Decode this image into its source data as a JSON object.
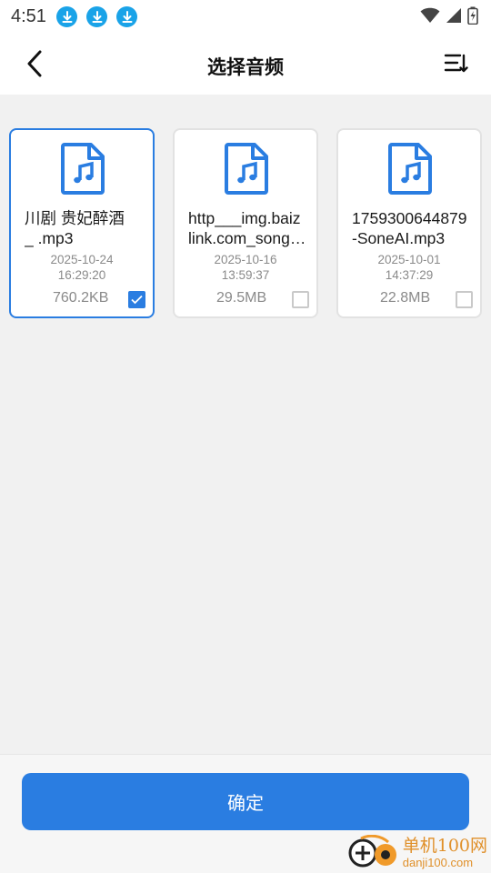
{
  "status_bar": {
    "time": "4:51",
    "notification_icons": [
      "download-icon",
      "download-icon",
      "download-icon"
    ],
    "system_icons": [
      "wifi-icon",
      "signal-icon",
      "battery-charging-icon"
    ]
  },
  "header": {
    "title": "选择音频",
    "back_icon": "chevron-left-icon",
    "sort_icon": "sort-icon"
  },
  "files": [
    {
      "name_line1": "川剧 贵妃醉酒",
      "name_line2": "_ .mp3",
      "date": "2025-10-24",
      "time": "16:29:20",
      "size": "760.2KB",
      "selected": true
    },
    {
      "name_line1": "http___img.baiz",
      "name_line2": "link.com_song…",
      "date": "2025-10-16",
      "time": "13:59:37",
      "size": "29.5MB",
      "selected": false
    },
    {
      "name_line1": "1759300644879",
      "name_line2": "-SoneAI.mp3",
      "date": "2025-10-01",
      "time": "14:37:29",
      "size": "22.8MB",
      "selected": false
    }
  ],
  "footer": {
    "confirm_label": "确定"
  },
  "watermark": {
    "title": "单机100网",
    "domain": "danji100.com"
  },
  "colors": {
    "accent": "#2a7de1",
    "background": "#f1f1f1",
    "download_badge": "#1aa3e8",
    "watermark": "#e0902a"
  }
}
